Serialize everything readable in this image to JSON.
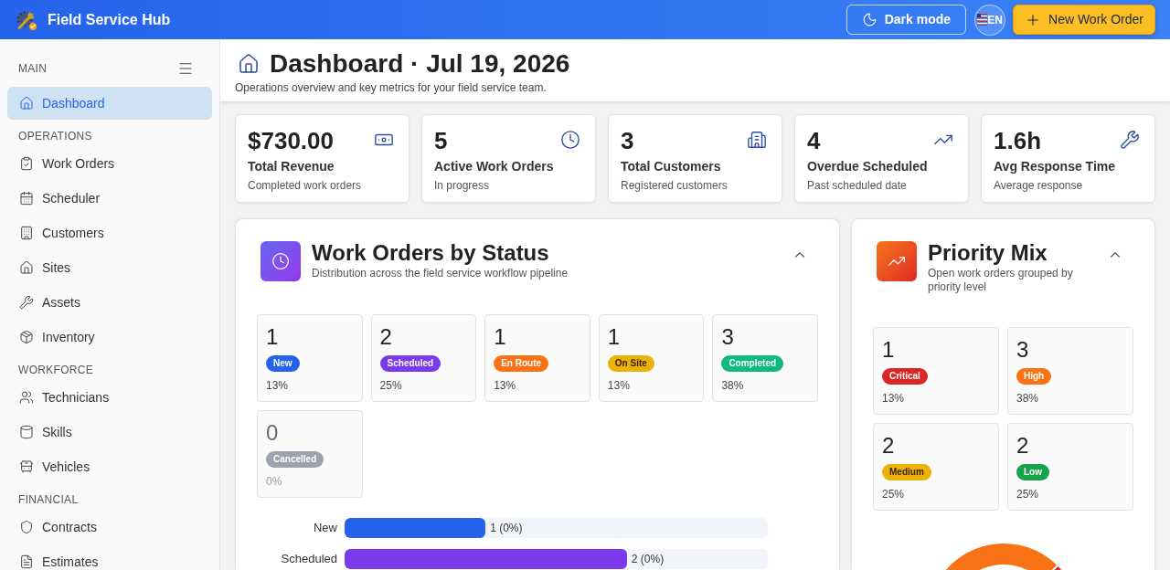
{
  "app_bar": {
    "title": "Field Service Hub",
    "dark_mode_button": {
      "label": "Dark mode"
    },
    "language_button": {
      "label": "EN"
    },
    "new_button": {
      "label": "New Work Order"
    }
  },
  "sidebar": {
    "sections": [
      {
        "label": "MAIN",
        "items": [
          {
            "label": "Dashboard",
            "selected": true
          }
        ]
      },
      {
        "label": "OPERATIONS",
        "items": [
          {
            "label": "Work Orders",
            "selected": false
          },
          {
            "label": "Scheduler",
            "selected": false
          },
          {
            "label": "Customers",
            "selected": false
          },
          {
            "label": "Sites",
            "selected": false
          },
          {
            "label": "Assets",
            "selected": false
          },
          {
            "label": "Inventory",
            "selected": false
          }
        ]
      },
      {
        "label": "WORKFORCE",
        "items": [
          {
            "label": "Technicians",
            "selected": false
          },
          {
            "label": "Skills",
            "selected": false
          },
          {
            "label": "Vehicles",
            "selected": false
          }
        ]
      },
      {
        "label": "FINANCIAL",
        "items": [
          {
            "label": "Contracts",
            "selected": false
          },
          {
            "label": "Estimates",
            "selected": false
          }
        ]
      }
    ]
  },
  "page_header": {
    "title": "Dashboard · Jul 19, 2026",
    "subtitle": "Operations overview and key metrics for your field service team."
  },
  "stats": [
    {
      "value": "$730.00",
      "label": "Total Revenue",
      "caption": "Completed work orders"
    },
    {
      "value": "5",
      "label": "Active Work Orders",
      "caption": "In progress"
    },
    {
      "value": "3",
      "label": "Total Customers",
      "caption": "Registered customers"
    },
    {
      "value": "4",
      "label": "Overdue Scheduled",
      "caption": "Past scheduled date"
    },
    {
      "value": "1.6h",
      "label": "Avg Response Time",
      "caption": "Average response"
    }
  ],
  "status_panel": {
    "title": "Work Orders by Status",
    "subtitle": "Distribution across the field service workflow pipeline",
    "expanded": true,
    "tiles": [
      {
        "count": "1",
        "label": "New",
        "percent": "13%",
        "color": "#2563eb",
        "dimmed": false
      },
      {
        "count": "2",
        "label": "Scheduled",
        "percent": "25%",
        "color": "#7c3aed",
        "dimmed": false
      },
      {
        "count": "1",
        "label": "En Route",
        "percent": "13%",
        "color": "#f97316",
        "dimmed": false
      },
      {
        "count": "1",
        "label": "On Site",
        "percent": "13%",
        "color": "#eab308",
        "dimmed": false
      },
      {
        "count": "3",
        "label": "Completed",
        "percent": "38%",
        "color": "#10b981",
        "dimmed": false
      },
      {
        "count": "0",
        "label": "Cancelled",
        "percent": "0%",
        "color": "#9ca3af",
        "dimmed": true
      }
    ],
    "bars": [
      {
        "label": "New",
        "level": 0.333,
        "reading": "1 (0%)",
        "color": "#2563eb"
      },
      {
        "label": "Scheduled",
        "level": 0.667,
        "reading": "2 (0%)",
        "color": "#7c3aed"
      }
    ]
  },
  "priority_panel": {
    "title": "Priority Mix",
    "subtitle": "Open work orders grouped by priority level",
    "expanded": true,
    "tiles": [
      {
        "count": "1",
        "label": "Critical",
        "percent": "13%",
        "color": "#dc2626"
      },
      {
        "count": "3",
        "label": "High",
        "percent": "38%",
        "color": "#f97316"
      },
      {
        "count": "2",
        "label": "Medium",
        "percent": "25%",
        "color": "#eab308"
      },
      {
        "count": "2",
        "label": "Low",
        "percent": "25%",
        "color": "#16a34a"
      }
    ]
  }
}
